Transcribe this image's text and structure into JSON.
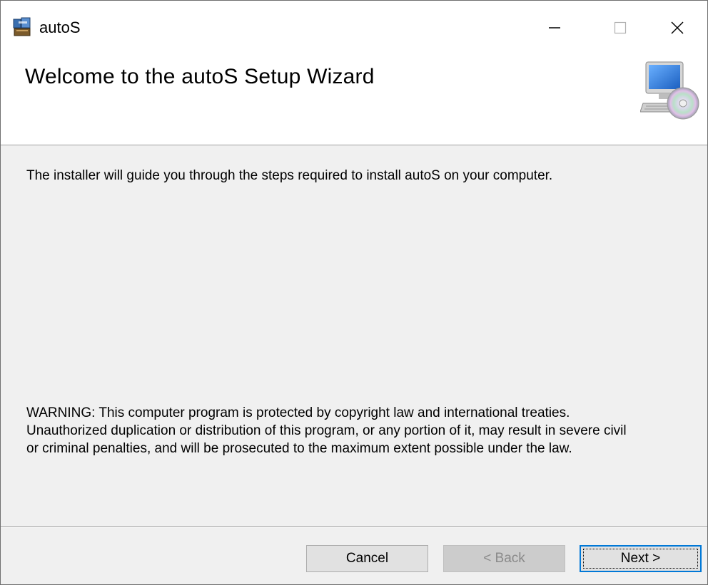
{
  "window": {
    "title": "autoS",
    "icon": "installer-package-icon",
    "controls": {
      "minimize": "minimize-icon",
      "maximize": "maximize-icon",
      "close": "close-icon"
    }
  },
  "banner": {
    "title": "Welcome to the autoS Setup Wizard",
    "art": "computer-with-cd-icon"
  },
  "body": {
    "intro": "The installer will guide you through the steps required to install autoS on your computer.",
    "warning_lines": [
      "WARNING: This computer program is protected by copyright law and international treaties.",
      "Unauthorized duplication or distribution of this program, or any portion of it, may result in severe civil",
      "or criminal penalties, and will be prosecuted to the maximum extent possible under the law."
    ]
  },
  "footer": {
    "cancel_label": "Cancel",
    "back_label": "< Back",
    "next_label": "Next >"
  },
  "colors": {
    "dialog_bg": "#f0f0f0",
    "header_bg": "#ffffff",
    "focus_border": "#0078d7",
    "disabled_text": "#8a8a8a"
  }
}
